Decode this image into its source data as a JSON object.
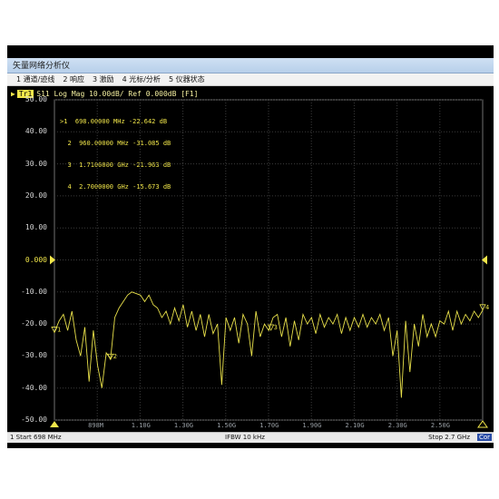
{
  "window": {
    "title": "矢量网络分析仪"
  },
  "menu": [
    "1 通道/迹线",
    "2 响应",
    "3 激励",
    "4 光标/分析",
    "5 仪器状态"
  ],
  "trace": {
    "badge": "Tr1",
    "label": "S11 Log Mag 10.00dB/ Ref 0.000dB [F1]",
    "color": "#e8e04a"
  },
  "markers": [
    {
      "id": ">1",
      "freq": "698.00000 MHz",
      "value": "-22.642 dB"
    },
    {
      "id": "2",
      "freq": "960.00000 MHz",
      "value": "-31.085 dB"
    },
    {
      "id": "3",
      "freq": "1.7100000 GHz",
      "value": "-21.963 dB"
    },
    {
      "id": "4",
      "freq": "2.7000000 GHz",
      "value": "-15.673 dB"
    }
  ],
  "status": {
    "left": "1  Start 698 MHz",
    "center": "IFBW 10 kHz",
    "right": "Stop 2.7 GHz",
    "badge": "Cor"
  },
  "chart_data": {
    "type": "line",
    "title": "S11 Log Mag 10.00dB/ Ref 0.000dB [F1]",
    "xlabel": "",
    "ylabel": "",
    "xlim": [
      0.698,
      2.7
    ],
    "ylim": [
      -50,
      50
    ],
    "yticks": [
      "50.00",
      "40.00",
      "30.00",
      "20.00",
      "10.00",
      "0.000",
      "-10.00",
      "-20.00",
      "-30.00",
      "-40.00",
      "-50.00"
    ],
    "xtick_labels": [
      {
        "x": 0.898,
        "label": "898M"
      },
      {
        "x": 1.1,
        "label": "1.10G"
      },
      {
        "x": 1.3,
        "label": "1.30G"
      },
      {
        "x": 1.5,
        "label": "1.50G"
      },
      {
        "x": 1.7,
        "label": "1.70G"
      },
      {
        "x": 1.9,
        "label": "1.90G"
      },
      {
        "x": 2.1,
        "label": "2.10G"
      },
      {
        "x": 2.3,
        "label": "2.30G"
      },
      {
        "x": 2.5,
        "label": "2.50G"
      }
    ],
    "grid": true,
    "series": [
      {
        "x": [
          0.698,
          0.72,
          0.74,
          0.76,
          0.78,
          0.8,
          0.82,
          0.84,
          0.86,
          0.88,
          0.9,
          0.92,
          0.94,
          0.96,
          0.98,
          1.0,
          1.02,
          1.04,
          1.06,
          1.08,
          1.1,
          1.12,
          1.14,
          1.16,
          1.18,
          1.2,
          1.22,
          1.24,
          1.26,
          1.28,
          1.3,
          1.32,
          1.34,
          1.36,
          1.38,
          1.4,
          1.42,
          1.44,
          1.46,
          1.48,
          1.5,
          1.52,
          1.54,
          1.56,
          1.58,
          1.6,
          1.62,
          1.64,
          1.66,
          1.68,
          1.7,
          1.72,
          1.74,
          1.76,
          1.78,
          1.8,
          1.82,
          1.84,
          1.86,
          1.88,
          1.9,
          1.92,
          1.94,
          1.96,
          1.98,
          2.0,
          2.02,
          2.04,
          2.06,
          2.08,
          2.1,
          2.12,
          2.14,
          2.16,
          2.18,
          2.2,
          2.22,
          2.24,
          2.26,
          2.28,
          2.3,
          2.32,
          2.34,
          2.36,
          2.38,
          2.4,
          2.42,
          2.44,
          2.46,
          2.48,
          2.5,
          2.52,
          2.54,
          2.56,
          2.58,
          2.6,
          2.62,
          2.64,
          2.66,
          2.68,
          2.7
        ],
        "y": [
          -22.6,
          -19,
          -17,
          -22,
          -16,
          -25,
          -30,
          -21,
          -38,
          -22,
          -33,
          -40,
          -29,
          -31,
          -18,
          -15,
          -13,
          -11,
          -10,
          -10.5,
          -11,
          -13,
          -11,
          -14,
          -15,
          -18,
          -16,
          -20,
          -15,
          -19,
          -14,
          -21,
          -16,
          -22,
          -17,
          -24,
          -17,
          -23,
          -20,
          -39,
          -18,
          -22,
          -18,
          -26,
          -17,
          -20,
          -30,
          -16,
          -24,
          -20,
          -22,
          -18,
          -17,
          -24,
          -18,
          -27,
          -19,
          -25,
          -17,
          -20,
          -18,
          -23,
          -17,
          -21,
          -18,
          -20,
          -17,
          -23,
          -18,
          -22,
          -18,
          -21,
          -17,
          -21,
          -18,
          -20,
          -17,
          -22,
          -18,
          -30,
          -22,
          -43,
          -19,
          -35,
          -20,
          -27,
          -17,
          -24,
          -20,
          -24,
          -19,
          -20,
          -16,
          -22,
          -16,
          -20,
          -17,
          -19,
          -16,
          -18,
          -15.7
        ]
      }
    ],
    "markers": [
      {
        "id": "1",
        "x": 0.698,
        "y": -22.642
      },
      {
        "id": "2",
        "x": 0.96,
        "y": -31.085
      },
      {
        "id": "3",
        "x": 1.71,
        "y": -21.963
      },
      {
        "id": "4",
        "x": 2.7,
        "y": -15.673
      }
    ],
    "reference_level": 0.0
  }
}
